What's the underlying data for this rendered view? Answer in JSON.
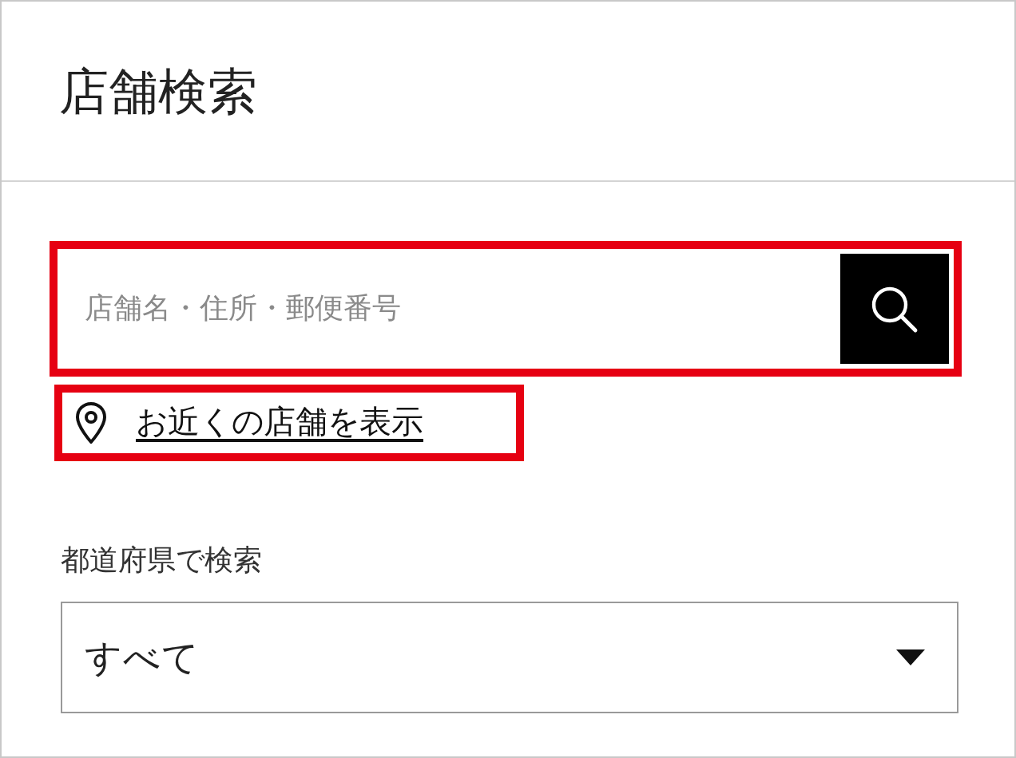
{
  "header": {
    "title": "店舗検索"
  },
  "search": {
    "placeholder": "店舗名・住所・郵便番号",
    "highlighted": true
  },
  "nearby_link": {
    "label": "お近くの店舗を表示",
    "highlighted": true
  },
  "prefecture": {
    "label": "都道府県で検索",
    "value": "すべて"
  }
}
